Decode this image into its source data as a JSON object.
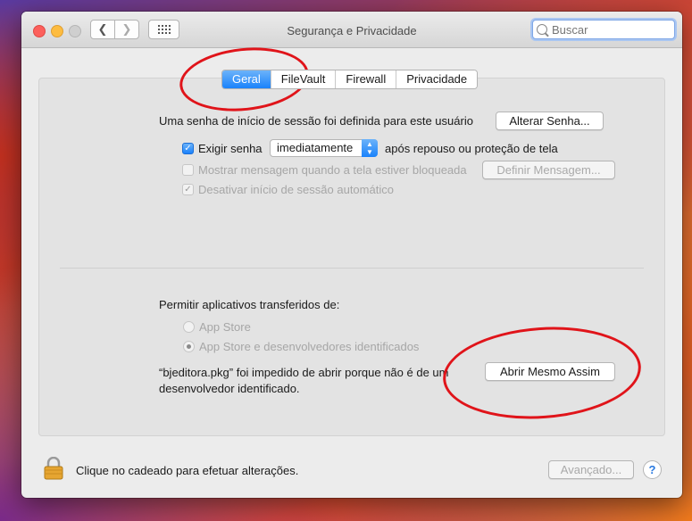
{
  "window": {
    "title": "Segurança e Privacidade",
    "search": {
      "value": "",
      "placeholder": "Buscar"
    }
  },
  "tabs": [
    {
      "label": "Geral",
      "active": true
    },
    {
      "label": "FileVault",
      "active": false
    },
    {
      "label": "Firewall",
      "active": false
    },
    {
      "label": "Privacidade",
      "active": false
    }
  ],
  "general": {
    "password_set_text": "Uma senha de início de sessão foi definida para este usuário",
    "change_password_button": "Alterar Senha...",
    "require_password_label": "Exigir senha",
    "require_password_select": "imediatamente",
    "require_password_suffix": "após repouso ou proteção de tela",
    "show_message_label": "Mostrar mensagem quando a tela estiver bloqueada",
    "set_message_button": "Definir Mensagem...",
    "disable_auto_login_label": "Desativar início de sessão automático"
  },
  "downloads": {
    "heading": "Permitir aplicativos transferidos de:",
    "option_app_store": "App Store",
    "option_app_store_devs": "App Store e desenvolvedores identificados",
    "blocked_line1": "“bjeditora.pkg” foi impedido de abrir porque não é de um",
    "blocked_line2": "desenvolvedor identificado.",
    "open_anyway_button": "Abrir Mesmo Assim"
  },
  "footer": {
    "lock_text": "Clique no cadeado para efetuar alterações.",
    "advanced_button": "Avançado...",
    "help_label": "?"
  },
  "colors": {
    "accent": "#1a82fb",
    "annotation": "#e0141a"
  }
}
